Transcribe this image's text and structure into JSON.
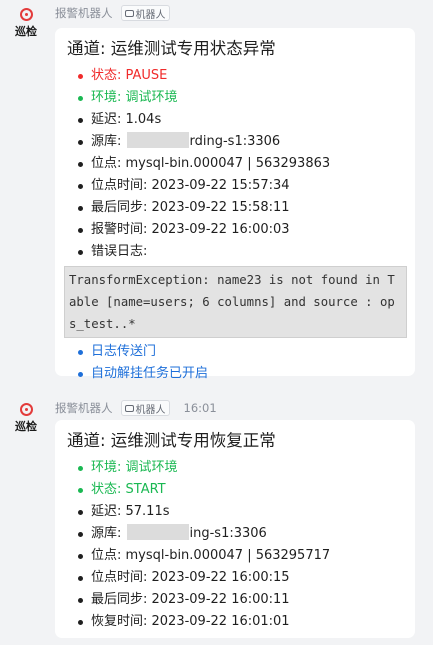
{
  "messages": [
    {
      "avatar_label": "巡检",
      "sender": "报警机器人",
      "bot_tag": "机器人",
      "time": "",
      "title": "通道: 运维测试专用状态异常",
      "status": "状态: PAUSE",
      "env": "环境: 调试环境",
      "delay": "延迟: 1.04s",
      "source_prefix": "源库: ",
      "source_suffix": "rding-s1:3306",
      "position": "位点: mysql-bin.000047 | 563293863",
      "position_time": "位点时间: 2023-09-22 15:57:34",
      "last_sync": "最后同步: 2023-09-22 15:58:11",
      "alarm_time": "报警时间: 2023-09-22 16:00:03",
      "error_label": "错误日志:",
      "error_text": "TransformException: name23 is not found in Table [name=users; 6 columns] and source : ops_test..*",
      "link_log": "日志传送门",
      "link_auto": "自动解挂任务已开启"
    },
    {
      "avatar_label": "巡检",
      "sender": "报警机器人",
      "bot_tag": "机器人",
      "time": "16:01",
      "title": "通道: 运维测试专用恢复正常",
      "env": "环境: 调试环境",
      "status": "状态: START",
      "delay": "延迟: 57.11s",
      "source_prefix": "源库: ",
      "source_suffix": "ing-s1:3306",
      "position": "位点: mysql-bin.000047 | 563295717",
      "position_time": "位点时间: 2023-09-22 16:00:15",
      "last_sync": "最后同步: 2023-09-22 16:00:11",
      "recover_time": "恢复时间: 2023-09-22 16:01:01"
    }
  ],
  "colors": {
    "alert_red": "#f02b2b",
    "ok_green": "#1ab852",
    "link_blue": "#1e6fd9",
    "page_bg": "#f2f3f5"
  }
}
